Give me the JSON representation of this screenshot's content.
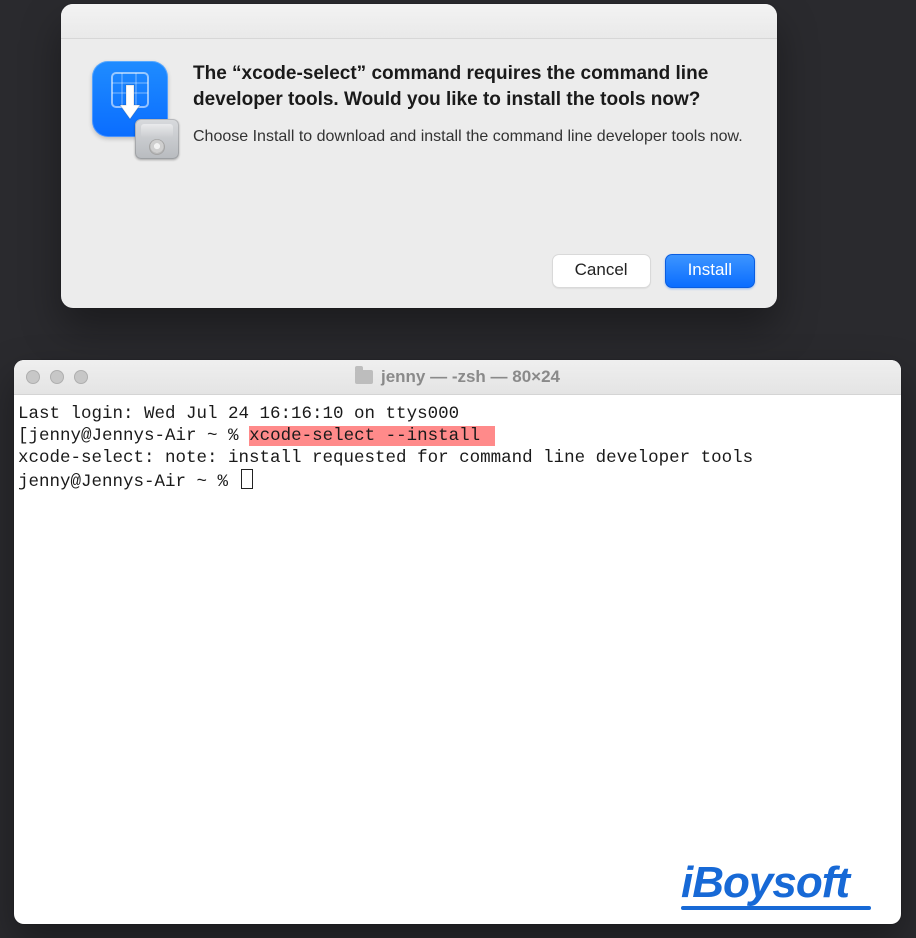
{
  "dialog": {
    "heading": "The “xcode-select” command requires the command line developer tools. Would you like to install the tools now?",
    "subtext": "Choose Install to download and install the command line developer tools now.",
    "cancel_label": "Cancel",
    "install_label": "Install",
    "icon_name": "xcode-download-icon",
    "badge_name": "install-disk-icon"
  },
  "terminal": {
    "title": "jenny — -zsh — 80×24",
    "lines": {
      "last_login": "Last login: Wed Jul 24 16:16:10 on ttys000",
      "prompt1": "jenny@Jennys-Air ~ % ",
      "highlighted_cmd": "xcode-select --install ",
      "note": "xcode-select: note: install requested for command line developer tools",
      "prompt2": "jenny@Jennys-Air ~ % "
    }
  },
  "watermark": "iBoysoft"
}
